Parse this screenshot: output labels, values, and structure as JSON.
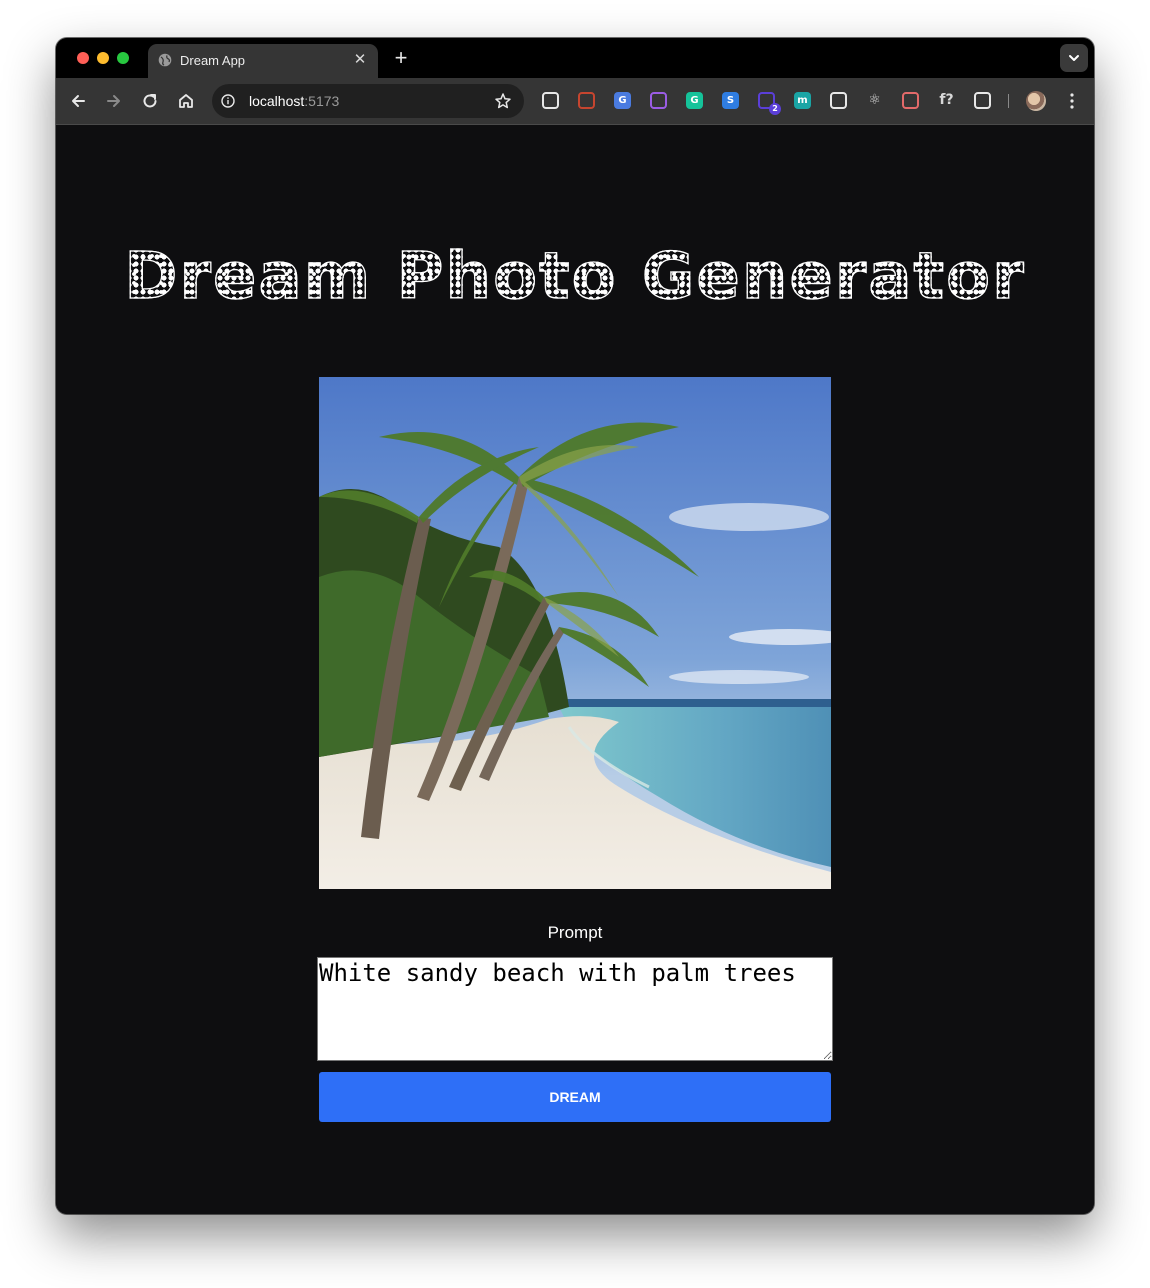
{
  "browser": {
    "tab_title": "Dream App",
    "tab_close_glyph": "✕",
    "new_tab_glyph": "+",
    "url_host": "localhost",
    "url_port": ":5173",
    "extensions": [
      {
        "name": "shield-extension-icon",
        "glyph": "",
        "color": "#e8e8e8"
      },
      {
        "name": "book-extension-icon",
        "glyph": "",
        "color": "#c6452f"
      },
      {
        "name": "translate-extension-icon",
        "glyph": "G",
        "color": "#4a7be0"
      },
      {
        "name": "purple-extension-icon",
        "glyph": "",
        "color": "#9b5de5"
      },
      {
        "name": "grammarly-extension-icon",
        "glyph": "G",
        "color": "#15c39a"
      },
      {
        "name": "s-extension-icon",
        "glyph": "S",
        "color": "#2f7de1"
      },
      {
        "name": "stack-extension-icon",
        "glyph": "",
        "color": "#5b3fd8",
        "badge": "2"
      },
      {
        "name": "m-extension-icon",
        "glyph": "m",
        "color": "#1aa5a5"
      },
      {
        "name": "eyedropper-extension-icon",
        "glyph": "",
        "color": "#e8e8e8"
      },
      {
        "name": "react-extension-icon",
        "glyph": "⚛",
        "color": "#d8d8d8"
      },
      {
        "name": "vpn-extension-icon",
        "glyph": "",
        "color": "#e36a6a"
      },
      {
        "name": "formula-extension-icon",
        "glyph": "f?",
        "color": "#d8d8d8"
      },
      {
        "name": "puzzle-extension-icon",
        "glyph": "",
        "color": "#e8e8e8"
      }
    ]
  },
  "page": {
    "title": "Dream Photo Generator",
    "prompt_label": "Prompt",
    "prompt_value": "White sandy beach with palm trees",
    "button_label": "DREAM"
  },
  "colors": {
    "page_background": "#0e0e10",
    "button": "#2e6ff7"
  }
}
